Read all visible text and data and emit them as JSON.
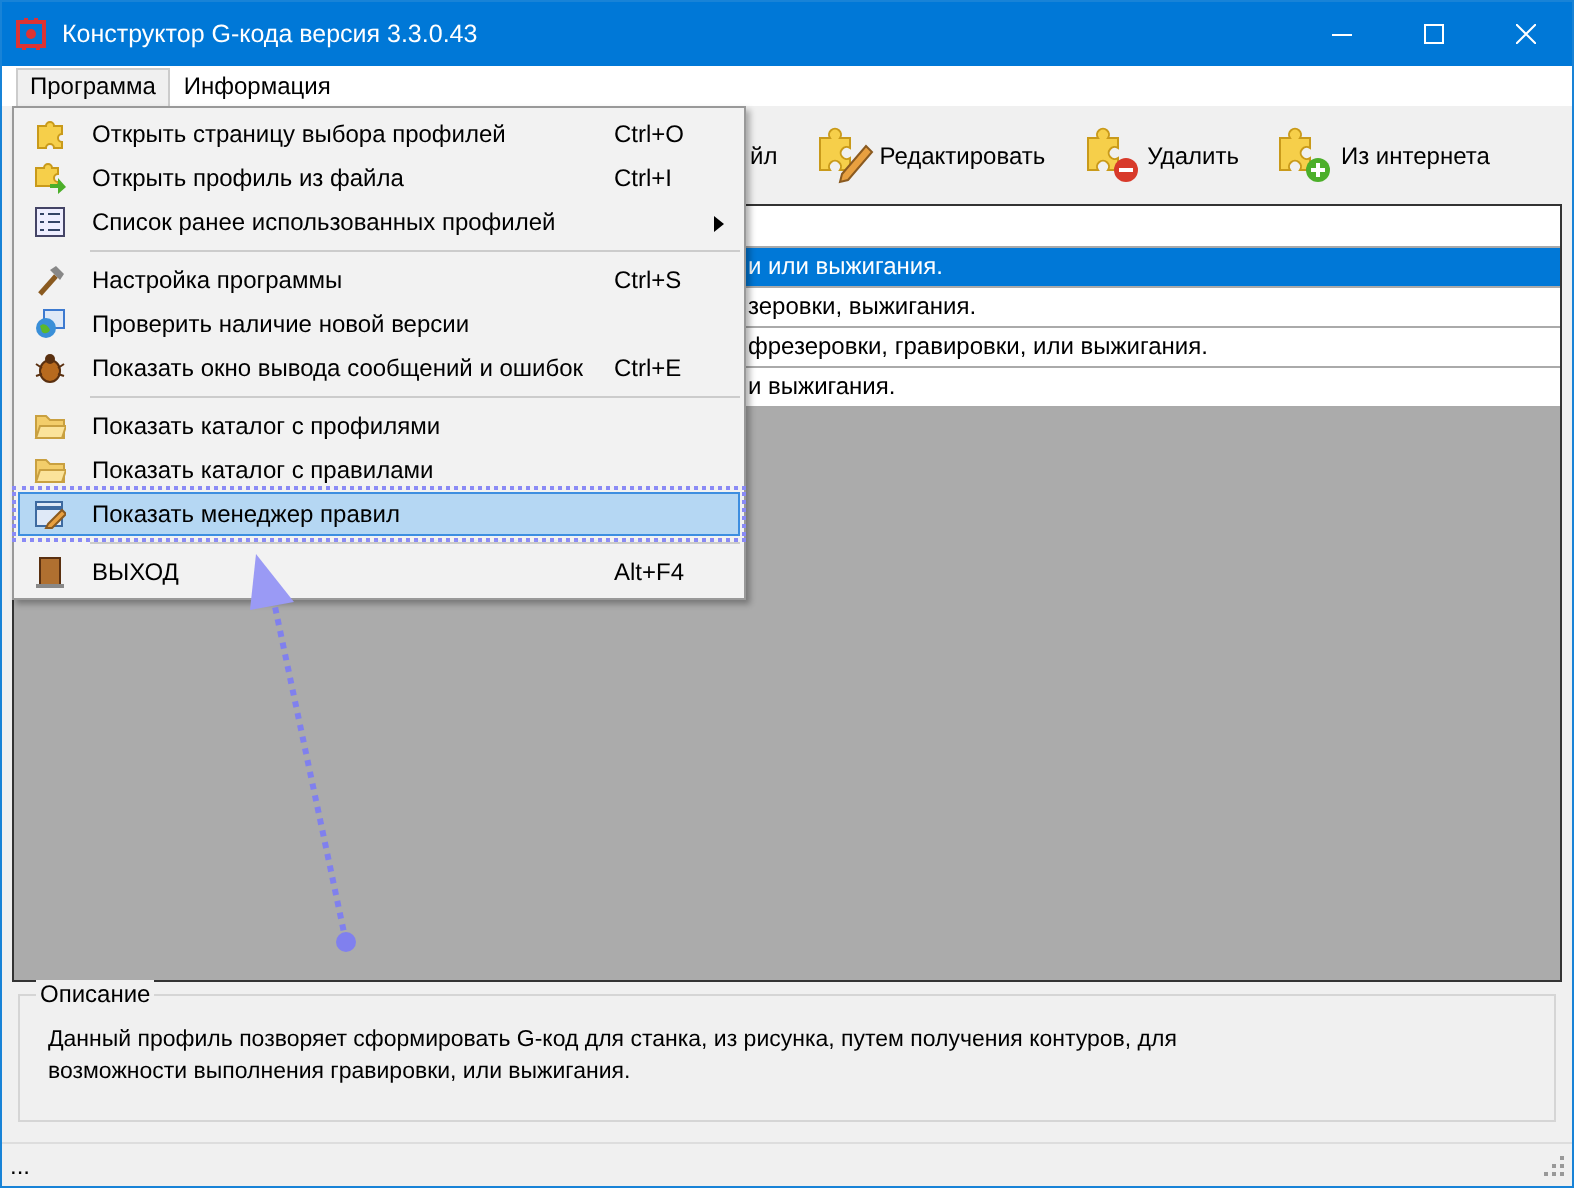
{
  "window": {
    "title": "Конструктор G-кода версия 3.3.0.43"
  },
  "menu_bar": [
    {
      "label": "Программа",
      "selected": true
    },
    {
      "label": "Информация",
      "selected": false
    }
  ],
  "menu": [
    {
      "kind": "item",
      "label": "Открыть страницу выбора профилей",
      "shortcut": "Ctrl+O",
      "selected": false
    },
    {
      "kind": "item",
      "label": "Открыть профиль из файла",
      "shortcut": "Ctrl+I",
      "selected": false
    },
    {
      "kind": "submenu",
      "label": "Список ранее использованных профилей",
      "selected": false
    },
    {
      "kind": "separator"
    },
    {
      "kind": "item",
      "label": "Настройка программы",
      "shortcut": "Ctrl+S",
      "selected": false
    },
    {
      "kind": "item",
      "label": "Проверить наличие новой версии",
      "selected": false
    },
    {
      "kind": "item",
      "label": "Показать окно вывода сообщений и ошибок",
      "shortcut": "Ctrl+E",
      "selected": false
    },
    {
      "kind": "separator"
    },
    {
      "kind": "item",
      "label": "Показать каталог с профилями",
      "selected": false
    },
    {
      "kind": "item",
      "label": "Показать каталог с правилами",
      "selected": false
    },
    {
      "kind": "item",
      "label": "Показать менеджер правил",
      "selected": true
    },
    {
      "kind": "separator"
    },
    {
      "kind": "item",
      "label": "ВЫХОД",
      "shortcut": "Alt+F4",
      "selected": false
    }
  ],
  "toolbar": [
    {
      "label": "йл"
    },
    {
      "label": "Редактировать"
    },
    {
      "label": "Удалить"
    },
    {
      "label": "Из интернета"
    }
  ],
  "profiles": {
    "rows": [
      {
        "text": "и или выжигания.",
        "selected": true
      },
      {
        "text": "зеровки, выжигания.",
        "selected": false
      },
      {
        "text": "фрезеровки, гравировки, или выжигания.",
        "selected": false
      },
      {
        "text": "и выжигания.",
        "selected": false
      }
    ]
  },
  "description": {
    "label": "Описание",
    "text": "Данный профиль позворяет сформировать G-код для станка, из рисунка, путем получения контуров, для возможности выполнения гравировки, или выжигания."
  },
  "status_bar": {
    "text": "..."
  }
}
